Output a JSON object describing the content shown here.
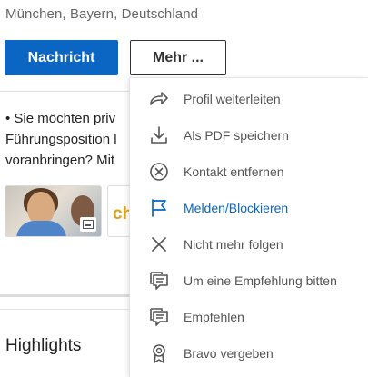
{
  "profile": {
    "location": "München, Bayern, Deutschland"
  },
  "actions": {
    "message_label": "Nachricht",
    "more_label": "Mehr ..."
  },
  "about": {
    "lines": [
      "• Sie möchten priv",
      "Führungsposition l",
      "voranbringen? Mit"
    ]
  },
  "featured": {
    "second_card_text": "ch"
  },
  "section": {
    "highlights_title": "Highlights"
  },
  "menu": {
    "items": [
      {
        "label": "Profil weiterleiten",
        "icon": "share-icon"
      },
      {
        "label": "Als PDF speichern",
        "icon": "download-icon"
      },
      {
        "label": "Kontakt entfernen",
        "icon": "remove-connection-icon"
      },
      {
        "label": "Melden/Blockieren",
        "icon": "flag-icon",
        "active": true
      },
      {
        "label": "Nicht mehr folgen",
        "icon": "close-icon"
      },
      {
        "label": "Um eine Empfehlung bitten",
        "icon": "recommendation-icon"
      },
      {
        "label": "Empfehlen",
        "icon": "recommendation-icon"
      },
      {
        "label": "Bravo vergeben",
        "icon": "award-icon"
      }
    ]
  },
  "colors": {
    "brand": "#0a66c2",
    "text_muted": "#666666"
  }
}
